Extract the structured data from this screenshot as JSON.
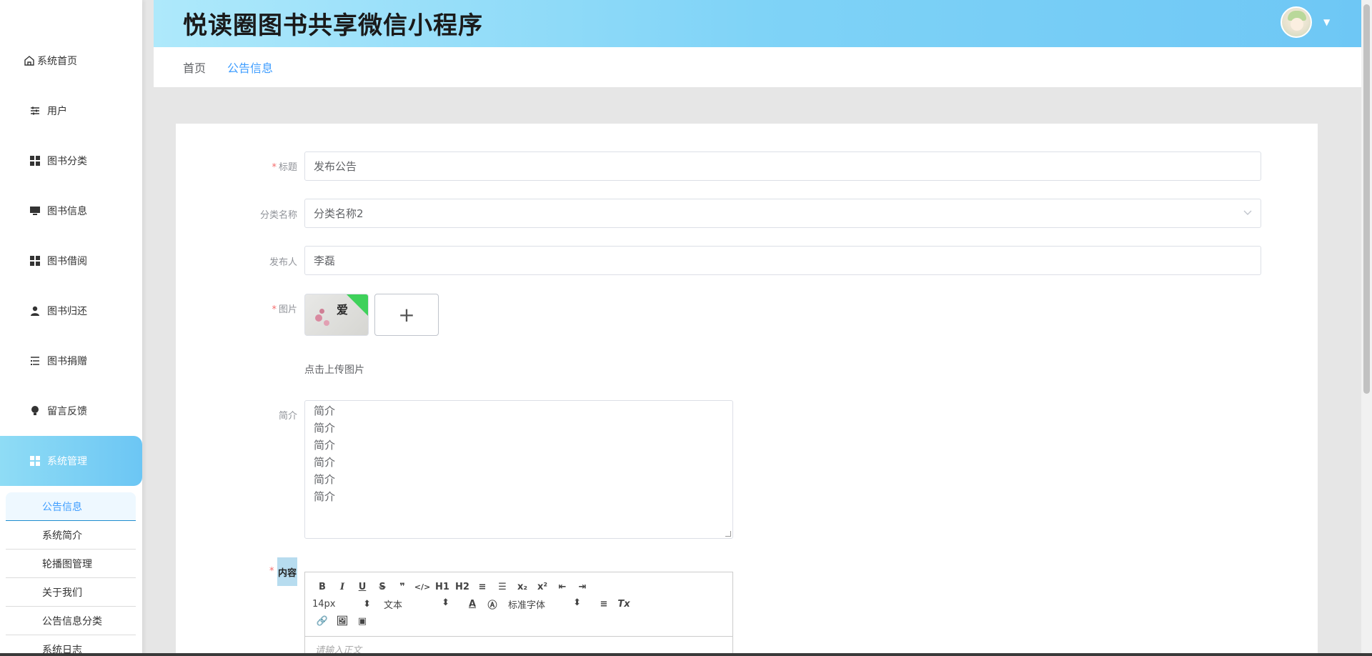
{
  "app": {
    "title": "悦读圈图书共享微信小程序"
  },
  "sidebar": {
    "items": [
      {
        "label": "系统首页",
        "icon": "home-icon"
      },
      {
        "label": "用户",
        "icon": "sliders-icon"
      },
      {
        "label": "图书分类",
        "icon": "grid-icon"
      },
      {
        "label": "图书信息",
        "icon": "monitor-icon"
      },
      {
        "label": "图书借阅",
        "icon": "grid-icon"
      },
      {
        "label": "图书归还",
        "icon": "user-icon"
      },
      {
        "label": "图书捐赠",
        "icon": "list-icon"
      },
      {
        "label": "留言反馈",
        "icon": "lightbulb-icon"
      },
      {
        "label": "系统管理",
        "icon": "grid-icon"
      }
    ],
    "submenu": [
      {
        "label": "公告信息"
      },
      {
        "label": "系统简介"
      },
      {
        "label": "轮播图管理"
      },
      {
        "label": "关于我们"
      },
      {
        "label": "公告信息分类"
      },
      {
        "label": "系统日志"
      }
    ]
  },
  "breadcrumb": {
    "home": "首页",
    "current": "公告信息"
  },
  "form": {
    "title_label": "标题",
    "title_value": "发布公告",
    "category_label": "分类名称",
    "category_value": "分类名称2",
    "publisher_label": "发布人",
    "publisher_value": "李磊",
    "image_label": "图片",
    "image_thumb_text": "爱",
    "upload_plus": "+",
    "upload_tip": "点击上传图片",
    "summary_label": "简介",
    "summary_lines": [
      "简介",
      "简介",
      "简介",
      "简介",
      "简介",
      "简介"
    ],
    "content_label": "内容",
    "required_mark": "*"
  },
  "editor": {
    "row1": [
      "B",
      "I",
      "U",
      "S",
      "❞",
      "</>",
      "H1",
      "H2",
      "≡",
      "☰",
      "x₂",
      "x²",
      "⇤",
      "⇥"
    ],
    "font_size": "14px",
    "text_type": "文本",
    "font_family": "标准字体",
    "row3": [
      "🔗",
      "🖼",
      "▣"
    ],
    "placeholder": "请输入正文"
  },
  "colors": {
    "accent": "#409eff",
    "header_gradient_start": "#aee9fb",
    "header_gradient_end": "#6ec7f5",
    "required": "#f56c6c"
  }
}
